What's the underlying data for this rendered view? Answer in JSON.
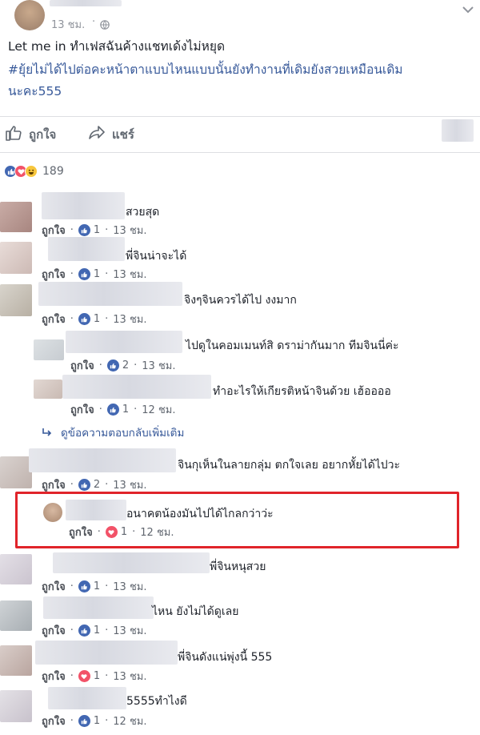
{
  "post": {
    "timestamp": "13 ชม.",
    "text_line1": "Let me in ทำเฟสฉันค้างแชทเด้งไม่หยุด",
    "text_line2": "#ยุ้ยไม่ได้ไปต่อคะหน้าตาแบบไหนแบบนั้นยังทำงานที่เดิมยังสวยเหมือนเดิม",
    "text_line3": "นะคะ555",
    "actions": {
      "like": "ถูกใจ",
      "share": "แชร์"
    },
    "reaction_count": "189",
    "privacy_icon": "globe-icon"
  },
  "comments": [
    {
      "text": "สวยสุด",
      "reply": false,
      "like_label": "ถูกใจ",
      "reaction": "like",
      "count": "1",
      "time": "13 ชม."
    },
    {
      "text": "พี่จินน่าจะได้",
      "reply": false,
      "like_label": "ถูกใจ",
      "reaction": "like",
      "count": "1",
      "time": "13 ชม."
    },
    {
      "text": "จิงๆจินควรได้ไป งงมาก",
      "reply": false,
      "like_label": "ถูกใจ",
      "reaction": "like",
      "count": "1",
      "time": "13 ชม."
    },
    {
      "text": "ไปดูในคอมเมนท์สิ ดราม่ากันมาก ทีมจินนี่ค่ะ",
      "reply": true,
      "like_label": "ถูกใจ",
      "reaction": "like",
      "count": "2",
      "time": "13 ชม."
    },
    {
      "text": "ทำอะไรให้เกียรติหน้าจินด้วย เฮ้ออออ",
      "reply": true,
      "like_label": "ถูกใจ",
      "reaction": "like",
      "count": "1",
      "time": "12 ชม."
    },
    {
      "text": "จินกุเห็นในลายกลุ่ม ตกใจเลย อยากหั้ยได้ไปวะ",
      "reply": false,
      "like_label": "ถูกใจ",
      "reaction": "like",
      "count": "2",
      "time": "13 ชม."
    },
    {
      "text": "อนาคตน้องมันไปได้ไกลกว่าว่ะ",
      "reply": true,
      "like_label": "ถูกใจ",
      "reaction": "love",
      "count": "1",
      "time": "12 ชม."
    },
    {
      "text": "พี่จินหนุสวย",
      "reply": false,
      "like_label": "ถูกใจ",
      "reaction": "like",
      "count": "1",
      "time": "13 ชม."
    },
    {
      "text": "ไหน ยังไม่ได้ดูเลย",
      "reply": false,
      "like_label": "ถูกใจ",
      "reaction": "like",
      "count": "1",
      "time": "13 ชม."
    },
    {
      "text": "พี่จินดังแน่พุ่งนี้ 555",
      "reply": false,
      "like_label": "ถูกใจ",
      "reaction": "love",
      "count": "1",
      "time": "13 ชม."
    },
    {
      "text": "5555ทำไงดี",
      "reply": false,
      "like_label": "ถูกใจ",
      "reaction": "like",
      "count": "1",
      "time": "12 ชม."
    }
  ],
  "view_more_replies": "ดูข้อความตอบกลับเพิ่มเติม",
  "colors": {
    "link_blue": "#365899",
    "like_blue": "#4267b2",
    "love_red": "#f25268",
    "highlight_red": "#e0242a"
  }
}
